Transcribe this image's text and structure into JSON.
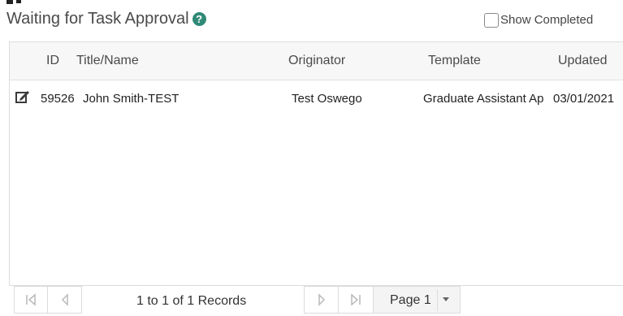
{
  "title": "Waiting for Task Approval",
  "show_completed": {
    "label": "Show Completed",
    "checked": false
  },
  "columns": {
    "id": "ID",
    "title": "Title/Name",
    "originator": "Originator",
    "template": "Template",
    "updated": "Updated"
  },
  "rows": [
    {
      "id": "59526",
      "title": "John Smith-TEST",
      "originator": "Test Oswego",
      "template": "Graduate Assistant Ap",
      "updated": "03/01/2021"
    }
  ],
  "pager": {
    "records": "1 to 1 of 1 Records",
    "page": "Page 1"
  },
  "colors": {
    "accent": "#2f8a77"
  }
}
